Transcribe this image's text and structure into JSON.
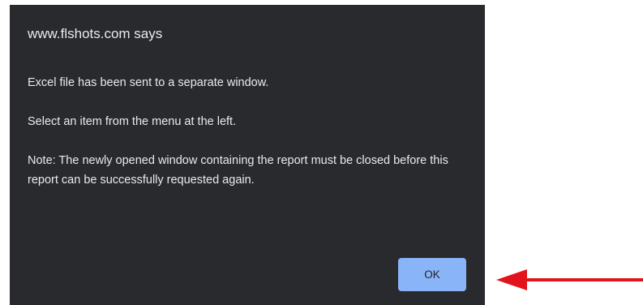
{
  "dialog": {
    "title": "www.flshots.com says",
    "messages": [
      "Excel file has been sent to a separate window.",
      "Select an item from the menu at the left.",
      "Note: The newly opened window containing the report must be closed before this report can be successfully requested again."
    ],
    "ok_label": "OK"
  },
  "annotation": {
    "arrow_icon": "red-arrow-left-icon",
    "arrow_color": "#e3131b"
  },
  "colors": {
    "dialog_background": "#292a2d",
    "dialog_text": "#e8eaed",
    "button_background": "#8ab4f8",
    "button_text": "#202124"
  }
}
